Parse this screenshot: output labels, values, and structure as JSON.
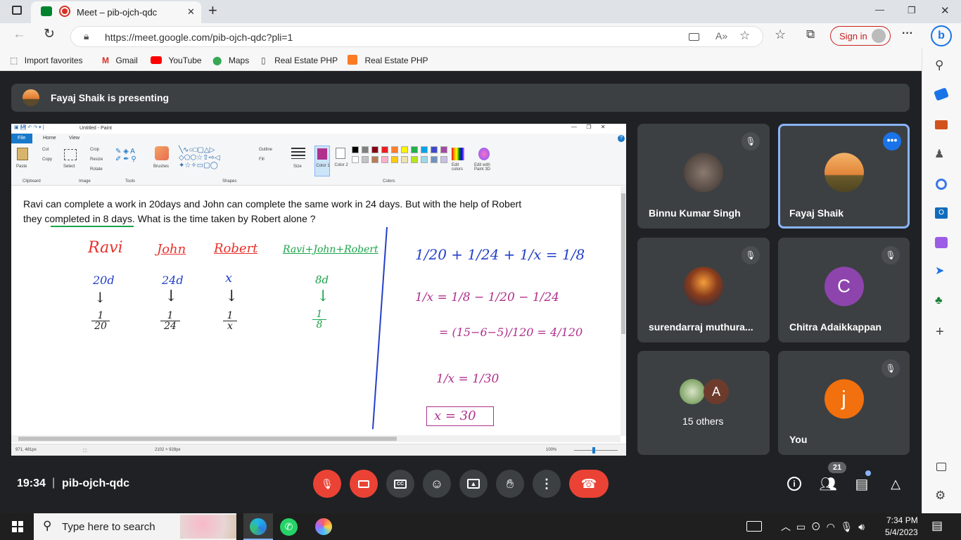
{
  "tab": {
    "title": "Meet – pib-ojch-qdc",
    "close": "✕",
    "new_tab": "+"
  },
  "window": {
    "minimize": "—",
    "restore": "❐",
    "close": "✕"
  },
  "address": {
    "url": "https://meet.google.com/pib-ojch-qdc?pli=1",
    "sign_in": "Sign in",
    "more": "···"
  },
  "favorites": [
    {
      "label": "Import favorites",
      "icon": "import-icon"
    },
    {
      "label": "Gmail",
      "icon": "gmail-icon"
    },
    {
      "label": "YouTube",
      "icon": "youtube-icon"
    },
    {
      "label": "Maps",
      "icon": "maps-icon"
    },
    {
      "label": "Real Estate PHP",
      "icon": "page-icon"
    },
    {
      "label": "Real Estate PHP",
      "icon": "xampp-icon"
    }
  ],
  "meet": {
    "banner": "Fayaj Shaik is presenting",
    "time": "19:34",
    "separator": "|",
    "code": "pib-ojch-qdc",
    "participant_count": "21",
    "participants": [
      {
        "name": "Binnu Kumar Singh",
        "muted": true
      },
      {
        "name": "Fayaj Shaik",
        "muted": false
      },
      {
        "name": "surendarraj muthura...",
        "muted": true
      },
      {
        "name": "Chitra Adaikkappan",
        "initial": "C",
        "muted": true
      },
      {
        "name": "15 others",
        "initial": "A"
      },
      {
        "name": "You",
        "initial": "j",
        "muted": true
      }
    ]
  },
  "paint": {
    "title": "Untitled - Paint",
    "tabs": [
      "File",
      "Home",
      "View"
    ],
    "groups": [
      "Clipboard",
      "Image",
      "Tools",
      "Shapes",
      "Colors"
    ],
    "clipboard": {
      "paste": "Paste",
      "cut": "Cut",
      "copy": "Copy"
    },
    "image": {
      "select": "Select",
      "crop": "Crop",
      "resize": "Resize",
      "rotate": "Rotate"
    },
    "brushes": "Brushes",
    "shapes": {
      "outline": "Outline",
      "fill": "Fill"
    },
    "size": "Size",
    "color1": "Color 1",
    "color2": "Color 2",
    "edit_colors": "Edit colors",
    "paint3d": "Edit with Paint 3D",
    "palette": [
      "#000000",
      "#7f7f7f",
      "#880015",
      "#ed1c24",
      "#ff7f27",
      "#fff200",
      "#22b14c",
      "#00a2e8",
      "#3f48cc",
      "#a349a4",
      "#ffffff",
      "#c3c3c3",
      "#b97a57",
      "#ffaec9",
      "#ffc90e",
      "#efe4b0",
      "#b5e61d",
      "#99d9ea",
      "#7092be",
      "#c8bfe7"
    ],
    "status": {
      "cursor": "971, 481px",
      "canvas_size": "2102 × 928px",
      "zoom": "100%"
    },
    "question_line1": "Ravi can complete a work in 20days and John can complete the same work in 24 days. But with the help of Robert",
    "question_line2": "they completed in 8 days. What is the time taken by Robert alone ?",
    "hw": {
      "ravi": "Ravi",
      "john": "John",
      "robert": "Robert",
      "all": "Ravi+John+Robert",
      "d1": "20d",
      "d2": "24d",
      "d3": "x",
      "d4": "8d",
      "arrow": "↓",
      "f1n": "1",
      "f1d": "20",
      "f2n": "1",
      "f2d": "24",
      "f3n": "1",
      "f3d": "x",
      "f4n": "1",
      "f4d": "8",
      "eq1": "1/20 + 1/24 + 1/x = 1/8",
      "eq2": "1/x = 1/8 − 1/20 − 1/24",
      "eq3": "= (15−6−5)/120 = 4/120",
      "eq4": "1/x = 1/30",
      "eq5": "x = 30"
    }
  },
  "taskbar": {
    "search": "Type here to search",
    "time": "7:34 PM",
    "date": "5/4/2023"
  },
  "colors": {
    "accent": "#8ab4f8",
    "end_call": "#ea4335",
    "red_hw": "#e8312c",
    "blue_hw": "#2340c8",
    "green_hw": "#1aa54a",
    "purple_hw": "#b0308c"
  }
}
